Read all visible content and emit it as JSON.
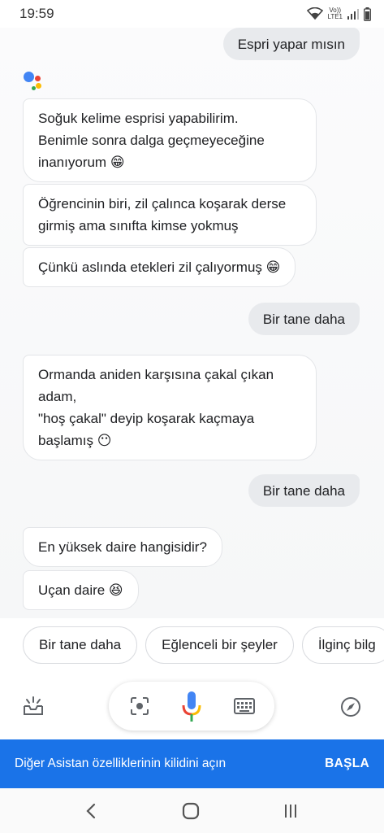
{
  "status_bar": {
    "time": "19:59",
    "volte_line1": "Vo))",
    "volte_line2": "LTE1"
  },
  "chat": {
    "messages": [
      {
        "from": "user",
        "text": "Espri yapar mısın"
      },
      {
        "from": "bot",
        "lines": [
          "Soğuk kelime esprisi yapabilirim.",
          "Benimle sonra dalga geçmeyeceğine",
          "inanıyorum 😁"
        ]
      },
      {
        "from": "bot",
        "lines": [
          "Öğrencinin biri, zil çalınca koşarak derse",
          "girmiş ama sınıfta kimse yokmuş"
        ]
      },
      {
        "from": "bot",
        "lines": [
          "Çünkü aslında etekleri zil çalıyormuş 😁"
        ]
      },
      {
        "from": "user",
        "text": "Bir tane daha"
      },
      {
        "from": "bot",
        "lines": [
          "Ormanda aniden karşısına çakal çıkan",
          "adam,",
          "\"hoş çakal\" deyip koşarak kaçmaya",
          "başlamış 😶"
        ]
      },
      {
        "from": "user",
        "text": "Bir tane daha"
      },
      {
        "from": "bot",
        "lines": [
          "En yüksek daire hangisidir?"
        ]
      },
      {
        "from": "bot",
        "lines": [
          "Uçan daire 😆"
        ]
      }
    ]
  },
  "suggestion_chips": [
    "Bir tane daha",
    "Eğlenceli bir şeyler",
    "İlginç bilg"
  ],
  "controls": {
    "left_icon": "updates-inbox-icon",
    "lens_icon": "lens-icon",
    "mic_icon": "mic-icon",
    "keyboard_icon": "keyboard-icon",
    "right_icon": "explore-compass-icon"
  },
  "banner": {
    "text": "Diğer Asistan özelliklerinin kilidini açın",
    "button": "BAŞLA",
    "color": "#1a73e8"
  },
  "nav": {
    "back_icon": "back-icon",
    "home_icon": "home-icon",
    "recents_icon": "recents-icon"
  },
  "colors": {
    "google_blue": "#4285f4",
    "google_red": "#ea4335",
    "google_yellow": "#fbbc05",
    "google_green": "#34a853"
  }
}
